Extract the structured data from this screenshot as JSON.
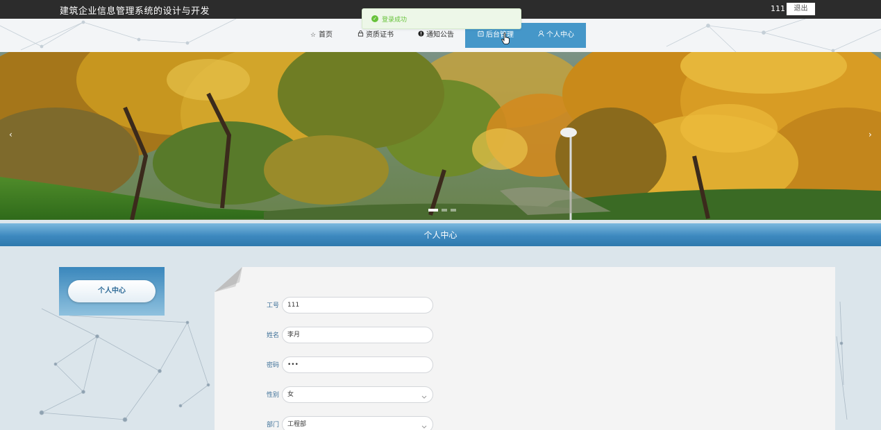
{
  "header": {
    "site_title": "建筑企业信息管理系统的设计与开发",
    "username": "111",
    "logout_label": "退出"
  },
  "nav": {
    "items": [
      {
        "label": "首页",
        "icon": "star-icon"
      },
      {
        "label": "资质证书",
        "icon": "lock-icon"
      },
      {
        "label": "通知公告",
        "icon": "info-icon"
      },
      {
        "label": "后台管理",
        "icon": "backend-icon"
      },
      {
        "label": "个人中心",
        "icon": "user-icon"
      }
    ],
    "active_index": 4
  },
  "toast": {
    "message": "登录成功",
    "icon": "check-circle-icon",
    "color": "#67c23a"
  },
  "banner": {
    "prev": "‹",
    "next": "›",
    "slide_count": 3,
    "active_slide": 1
  },
  "section": {
    "title": "个人中心"
  },
  "sidebar": {
    "button_label": "个人中心"
  },
  "form": {
    "fields": [
      {
        "label": "工号",
        "value": "111",
        "type": "text"
      },
      {
        "label": "姓名",
        "value": "李月",
        "type": "text"
      },
      {
        "label": "密码",
        "value": "•••",
        "type": "password"
      },
      {
        "label": "性别",
        "value": "女",
        "type": "select"
      },
      {
        "label": "部门",
        "value": "工程部",
        "type": "select"
      }
    ]
  },
  "colors": {
    "accent": "#4597c9",
    "topbar": "#2c2c2c",
    "success": "#67c23a"
  }
}
